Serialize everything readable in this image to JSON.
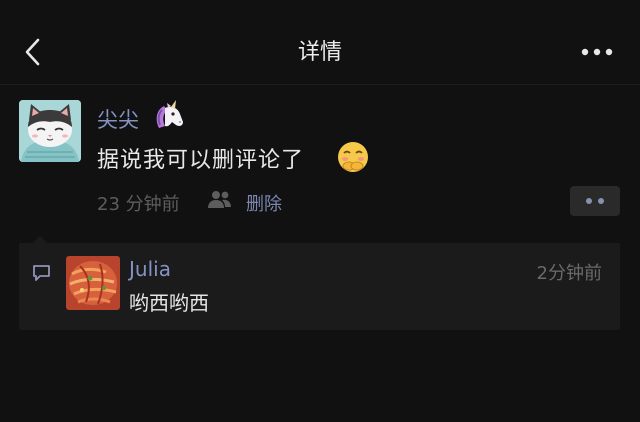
{
  "header": {
    "title": "详情",
    "back_icon": "chevron-left-icon",
    "more_icon": "more-dots-icon"
  },
  "post": {
    "author": "尖尖",
    "author_emoji": "unicorn-icon",
    "text": "据说我可以删评论了",
    "text_emoji": "smirk-face-icon",
    "time": "23 分钟前",
    "visibility_icon": "people-icon",
    "delete_label": "删除",
    "action_icon": "two-dots-icon"
  },
  "comments": [
    {
      "author": "Julia",
      "time": "2分钟前",
      "text": "哟西哟西"
    }
  ],
  "colors": {
    "background": "#111111",
    "name_link": "#8592c4",
    "comment_box": "#1b1b1b",
    "muted_text": "#5d5d5d"
  }
}
